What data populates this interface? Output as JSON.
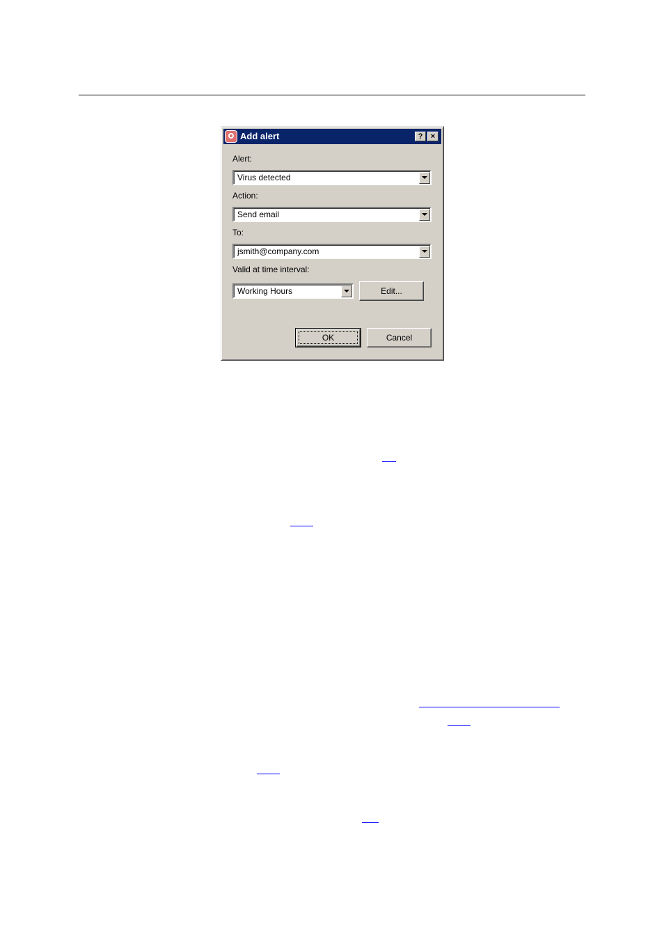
{
  "dialog": {
    "title": "Add alert",
    "help_button": "?",
    "close_button": "×",
    "alert_label": "Alert:",
    "alert_value": "Virus detected",
    "action_label": "Action:",
    "action_value": "Send email",
    "to_label": "To:",
    "to_value": "jsmith@company.com",
    "interval_label": "Valid at time interval:",
    "interval_value": "Working Hours",
    "edit_button": "Edit...",
    "ok_button": "OK",
    "cancel_button": "Cancel"
  },
  "colors": {
    "titlebar": "#0a246a",
    "dialog_face": "#d4d0c8",
    "link": "#0000ff"
  }
}
